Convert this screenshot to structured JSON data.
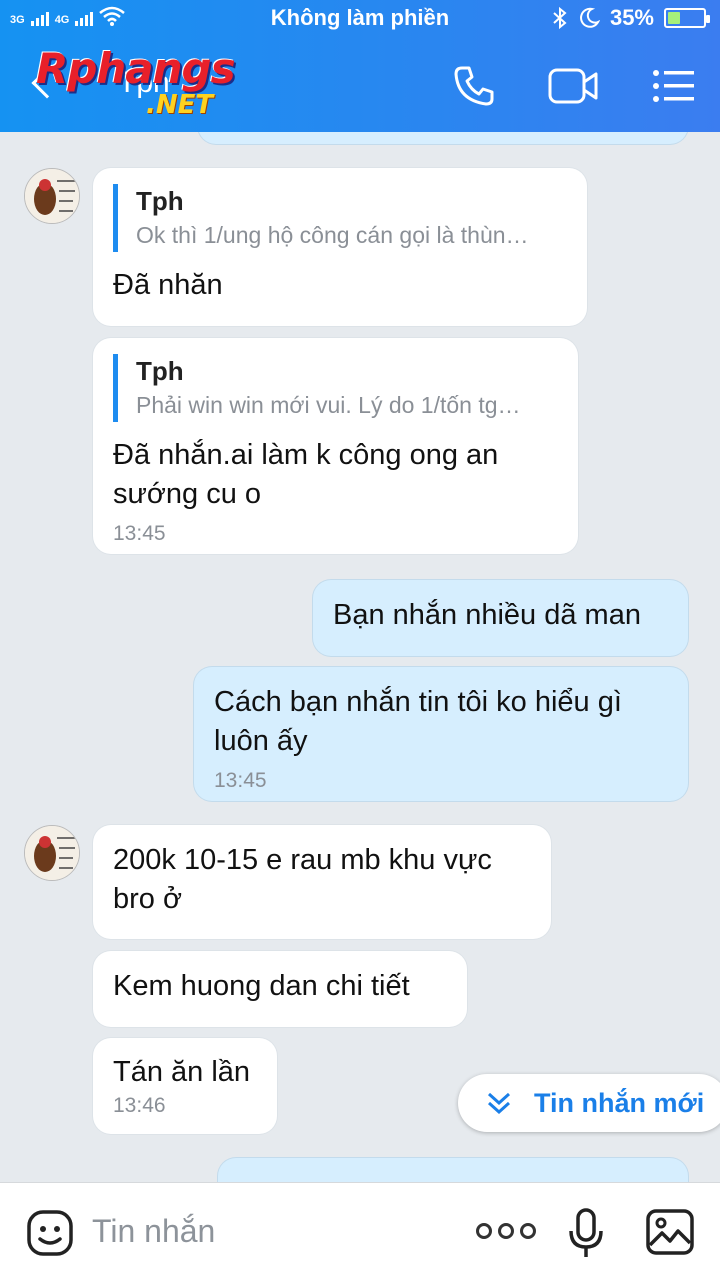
{
  "status_bar": {
    "network_1": "3G",
    "network_2": "4G",
    "title": "Không làm phiền",
    "battery": "35%",
    "battery_level": 0.35
  },
  "header": {
    "chat_name": "Tph",
    "logo_text": "Rphangs",
    "logo_suffix": ".NET"
  },
  "messages": [
    {
      "side": "in",
      "quote_name": "Tph",
      "quote_text": "Ok thì 1/ung hộ công cán gọi là thùn…",
      "text": "Đã nhăn",
      "time": ""
    },
    {
      "side": "in",
      "quote_name": "Tph",
      "quote_text": "Phải win win mới vui. Lý do 1/tốn tg…",
      "text": "Đã nhắn.ai làm k công ong an sướng cu o",
      "time": "13:45"
    },
    {
      "side": "out",
      "text": "Bạn nhắn nhiều dã man",
      "time": ""
    },
    {
      "side": "out",
      "text": "Cách bạn nhắn tin tôi ko hiểu gì luôn ấy",
      "time": "13:45"
    },
    {
      "side": "in",
      "text": "200k 10-15 e rau mb khu vực bro ở",
      "time": ""
    },
    {
      "side": "in",
      "text": "Kem huong dan chi tiết",
      "time": ""
    },
    {
      "side": "in",
      "text": "Tán ăn lần",
      "time": "13:46"
    }
  ],
  "new_message_button": "Tin nhắn mới",
  "input": {
    "placeholder": "Tin nhắn"
  },
  "colors": {
    "header": "#1e8cf0",
    "incoming": "#ffffff",
    "outgoing": "#d6eefe",
    "accent": "#1a7fe8"
  }
}
